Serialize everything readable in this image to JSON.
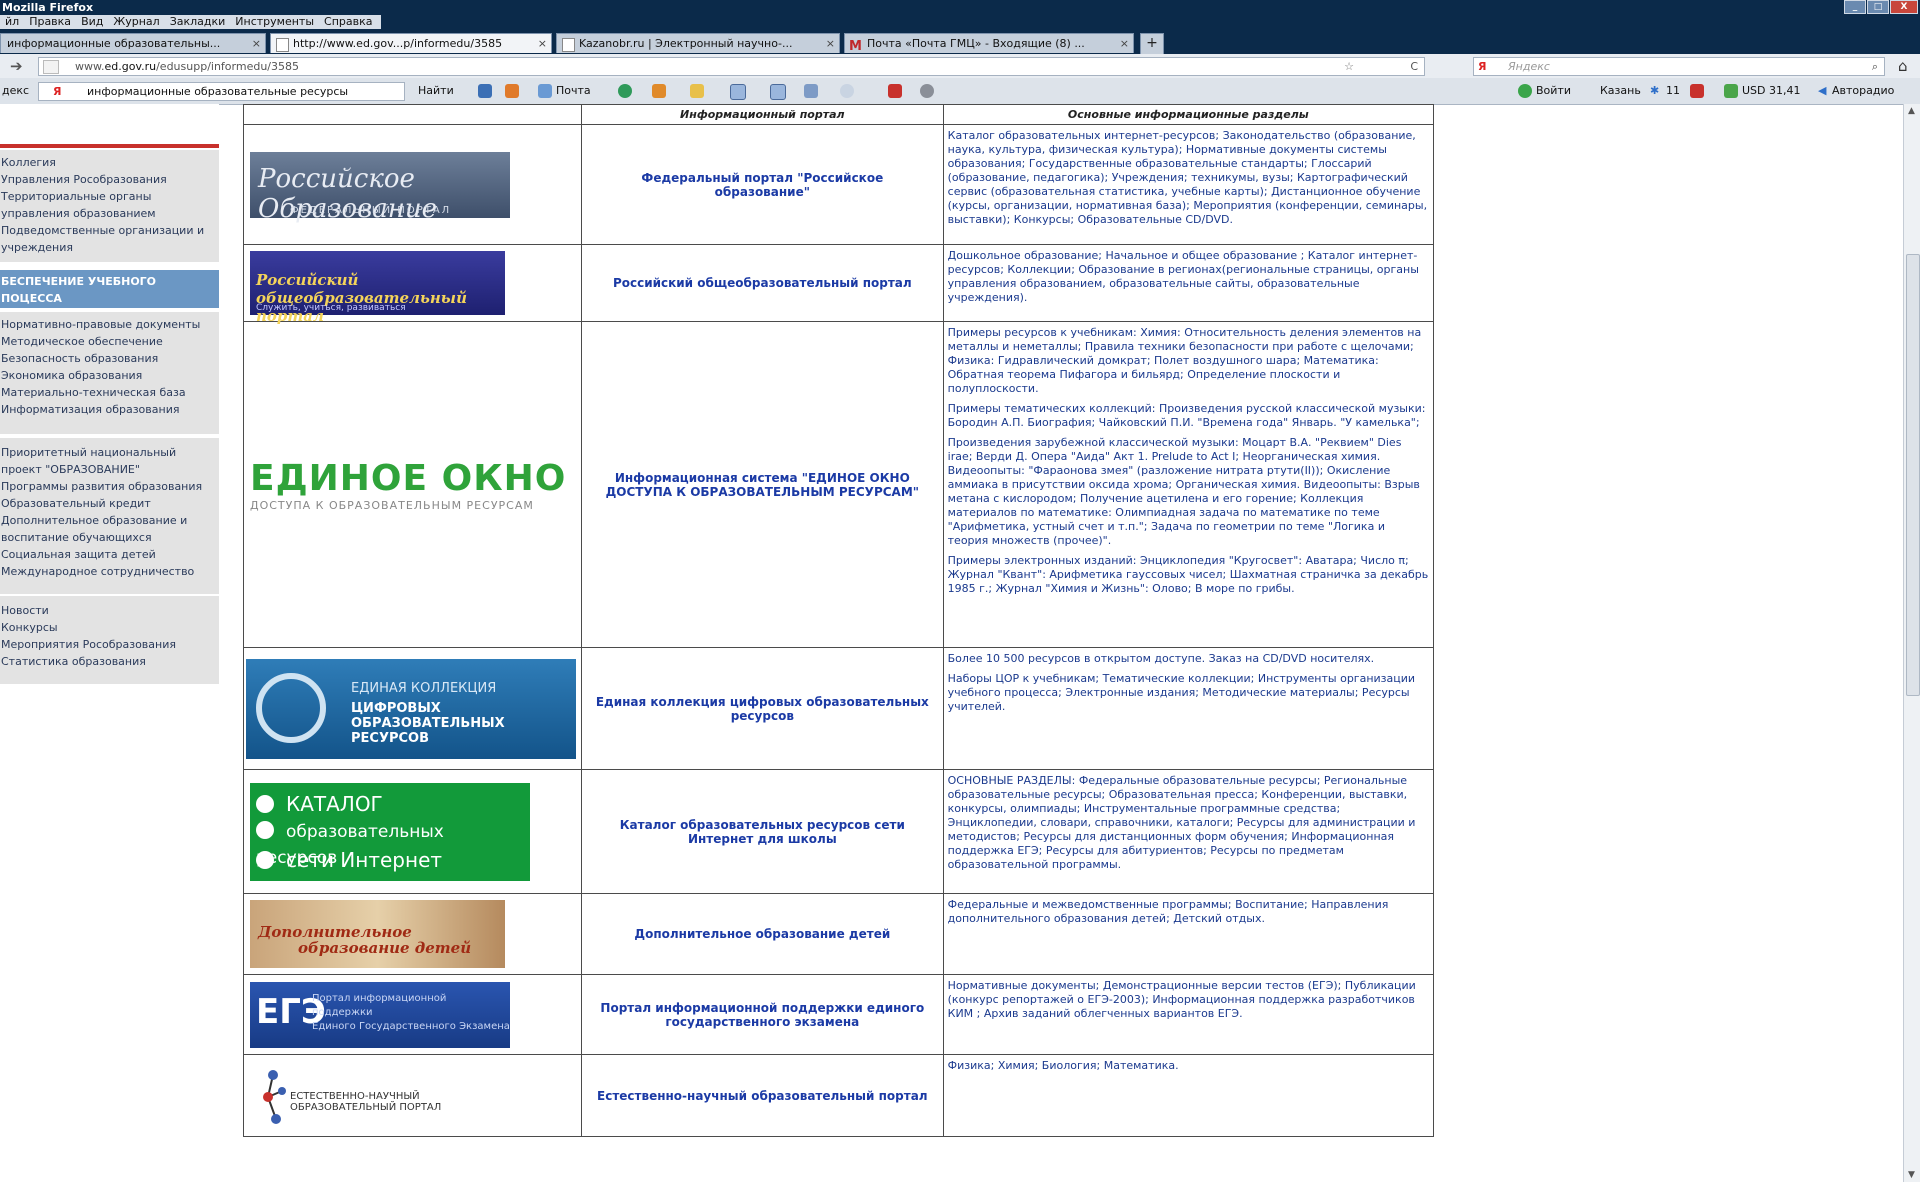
{
  "window": {
    "title": "Mozilla Firefox"
  },
  "menu": [
    "йл",
    "Правка",
    "Вид",
    "Журнал",
    "Закладки",
    "Инструменты",
    "Справка"
  ],
  "tabs": [
    {
      "label": "информационные образовательны...",
      "close": "×"
    },
    {
      "label": "http://www.ed.gov...p/informedu/3585",
      "close": "×"
    },
    {
      "label": "Kazanobr.ru | Электронный научно-...",
      "close": "×"
    },
    {
      "label": "Почта «Почта ГМЦ» - Входящие (8) ...",
      "close": "×"
    }
  ],
  "newtab": "+",
  "address": {
    "prefix": "www.",
    "domain": "ed.gov.ru",
    "path": "/edusupp/informedu/3585"
  },
  "search": {
    "placeholder": "Яндекс"
  },
  "toolbar": {
    "brand": "декс",
    "query": "информационные образовательные ресурсы",
    "find": "Найти",
    "mail": "Почта",
    "login": "Войти",
    "city": "Казань",
    "temp": "11",
    "currency": "USD 31,41",
    "traffic": "Авторадио"
  },
  "sidebar": {
    "group1": [
      "Коллегия",
      "Управления Рособразования",
      "Территориальные органы",
      "управления образованием",
      "Подведомственные организации и",
      "учреждения"
    ],
    "heading": "БЕСПЕЧЕНИЕ УЧЕБНОГО ПОЦЕССА",
    "group2": [
      "Нормативно-правовые документы",
      "Методическое обеспечение",
      "Безопасность образования",
      "Экономика образования",
      "Материально-техническая база",
      "Информатизация образования"
    ],
    "group3": [
      "Приоритетный национальный",
      "проект \"ОБРАЗОВАНИЕ\"",
      "Программы развития образования",
      "Образовательный кредит",
      "Дополнительное образование и",
      "воспитание обучающихся",
      "Социальная защита детей",
      "Международное сотрудничество"
    ],
    "group4": [
      "Новости",
      "Конкурсы",
      "Мероприятия Рособразования",
      "Статистика образования"
    ]
  },
  "table": {
    "headers": [
      "Информационный портал",
      "Основные информационные разделы"
    ],
    "rows": [
      {
        "logo": {
          "main": "Российское Образование",
          "sub": "ФЕДЕРАЛЬНЫЙ ПОРТАЛ"
        },
        "name": "Федеральный портал \"Российское образование\"",
        "desc": [
          "Каталог образовательных интернет-ресурсов; Законодательство (образование, наука, культура, физическая культура); Нормативные документы системы образования; Государственные образовательные стандарты; Глоссарий (образование, педагогика); Учреждения; техникумы, вузы; Картографический сервис (образовательная статистика, учебные карты); Дистанционное обучение (курсы, организации, нормативная база); Мероприятия (конференции, семинары, выставки); Конкурсы; Образовательные CD/DVD."
        ]
      },
      {
        "logo": {
          "main": "Российский общеобразовательный портал",
          "sub": "Служить, учиться, развиваться"
        },
        "name": "Российский общеобразовательный портал",
        "desc": [
          "Дошкольное образование; Начальное и общее образование ; Каталог интернет-ресурсов; Коллекции; Образование в регионах(региональные страницы, органы управления образованием, образовательные сайты, образовательные учреждения)."
        ]
      },
      {
        "logo": {
          "main": "ЕДИНОЕ ОКНО",
          "sub": "ДОСТУПА К ОБРАЗОВАТЕЛЬНЫМ РЕСУРСАМ"
        },
        "name": "Информационная система \"ЕДИНОЕ ОКНО ДОСТУПА К ОБРАЗОВАТЕЛЬНЫМ РЕСУРСАМ\"",
        "desc": [
          "Примеры ресурсов к учебникам: Химия: Относительность деления элементов на металлы и неметаллы; Правила техники безопасности при работе с щелочами; Физика: Гидравлический домкрат; Полет воздушного шара; Математика: Обратная теорема Пифагора и бильярд; Определение плоскости и полуплоскости.",
          "Примеры тематических коллекций: Произведения русской классической музыки: Бородин А.П. Биография; Чайковский П.И. \"Времена года\" Январь. \"У камелька\";",
          "Произведения зарубежной классической музыки: Моцарт В.А. \"Реквием\" Dies irae; Верди Д. Опера \"Аида\" Акт 1. Prelude to Act I; Неорганическая химия. Видеоопыты: \"Фараонова змея\" (разложение нитрата ртути(II)); Окисление аммиака в присутствии оксида хрома; Органическая химия. Видеоопыты: Взрыв метана с кислородом; Получение ацетилена и его горение; Коллекция материалов по математике: Олимпиадная задача по математике по теме \"Арифметика, устный счет и т.п.\"; Задача по геометрии по теме \"Логика и теория множеств (прочее)\".",
          "Примеры электронных изданий: Энциклопедия \"Кругосвет\": Аватара; Число π; Журнал \"Квант\": Арифметика гауссовых чисел; Шахматная страничка за декабрь 1985 г.; Журнал \"Химия и Жизнь\": Олово; В море по грибы."
        ]
      },
      {
        "logo": {
          "main": "ЕДИНАЯ КОЛЛЕКЦИЯ",
          "sub": "ЦИФРОВЫХ ОБРАЗОВАТЕЛЬНЫХ РЕСУРСОВ"
        },
        "name": "Единая коллекция цифровых образовательных ресурсов",
        "desc": [
          "Более 10 500 ресурсов в открытом доступе. Заказ на CD/DVD носителях.",
          "Наборы ЦОР к учебникам; Тематические коллекции; Инструменты организации учебного процесса; Электронные издания; Методические материалы; Ресурсы учителей."
        ]
      },
      {
        "logo": {
          "l1": "КАТАЛОГ",
          "l2": "образовательных ресурсов",
          "l3": "сети Интернет"
        },
        "name": "Каталог образовательных ресурсов сети Интернет для школы",
        "desc": [
          "ОСНОВНЫЕ РАЗДЕЛЫ: Федеральные образовательные ресурсы; Региональные образовательные ресурсы; Образовательная пресса; Конференции, выставки, конкурсы, олимпиады; Инструментальные программные средства; Энциклопедии, словари, справочники, каталоги; Ресурсы для администрации и методистов; Ресурсы для дистанционных форм обучения; Информационная поддержка ЕГЭ; Ресурсы для абитуриентов; Ресурсы по предметам образовательной программы."
        ]
      },
      {
        "logo": {
          "l1": "Дополнительное",
          "l2": "образование детей"
        },
        "name": "Дополнительное образование детей",
        "desc": [
          "Федеральные и межведомственные программы; Воспитание; Направления дополнительного образования детей; Детский отдых."
        ]
      },
      {
        "logo": {
          "main": "ЕГЭ",
          "l1": "Портал информационной поддержки",
          "l2": "Единого Государственного Экзамена"
        },
        "name": "Портал информационной поддержки единого государственного экзамена",
        "desc": [
          "Нормативные документы; Демонстрационные версии тестов (ЕГЭ); Публикации (конкурс репортажей о ЕГЭ-2003); Информационная поддержка разработчиков КИМ ; Архив заданий облегченных вариантов ЕГЭ."
        ]
      },
      {
        "logo": {
          "sub": "ЕСТЕСТВЕННО-НАУЧНЫЙ ОБРАЗОВАТЕЛЬНЫЙ ПОРТАЛ"
        },
        "name": "Естественно-научный образовательный портал",
        "desc": [
          "Физика; Химия; Биология; Математика."
        ]
      }
    ]
  }
}
